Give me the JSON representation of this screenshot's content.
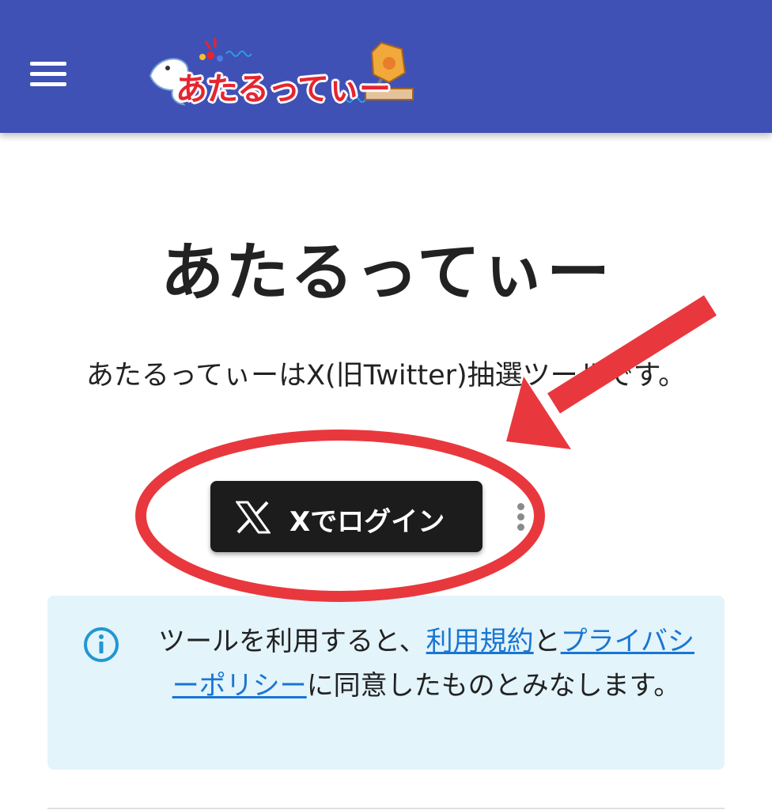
{
  "header": {
    "logo_text": "あたるってぃー"
  },
  "title": "あたるってぃー",
  "description": "あたるってぃーはX(旧Twitter)抽選ツールです。",
  "login_button": {
    "label": "Xでログイン"
  },
  "notice": {
    "prefix": "ツールを利用すると、",
    "terms_link": "利用規約",
    "middle": "と",
    "privacy_link": "プライバシーポリシー",
    "suffix": "に同意したものとみなします。"
  },
  "colors": {
    "header": "#3f51b5",
    "button": "#1c1c1c",
    "info_bg": "#e3f4fb",
    "link": "#1976d2",
    "annotation": "#e8383d"
  },
  "icons": [
    "menu-icon",
    "x-logo-icon",
    "info-icon",
    "more-vertical-icon"
  ]
}
